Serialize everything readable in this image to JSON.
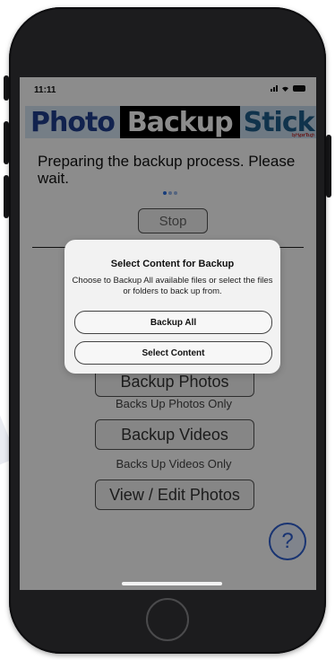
{
  "status_bar": {
    "time": "11:11"
  },
  "banner": {
    "word1": "Photo",
    "word2": "Backup",
    "word3": "Stick",
    "sub": "by Hyper Tough"
  },
  "main": {
    "progress_text": "Preparing the backup process. Please wait.",
    "stop_label": "Stop",
    "backup_photos_label": "Backup Photos",
    "backup_photos_caption": "Backs Up Photos Only",
    "backup_videos_label": "Backup Videos",
    "backup_videos_caption": "Backs Up Videos Only",
    "view_edit_label": "View / Edit Photos",
    "help_label": "?"
  },
  "dialog": {
    "title": "Select Content for Backup",
    "message": "Choose to Backup All available files or select the files or folders to back up from.",
    "backup_all_label": "Backup All",
    "select_content_label": "Select Content"
  },
  "colors": {
    "accent": "#2f5fd0",
    "banner_blue": "#1f3f8e",
    "dim_overlay": "rgba(0,0,0,0.45)"
  }
}
